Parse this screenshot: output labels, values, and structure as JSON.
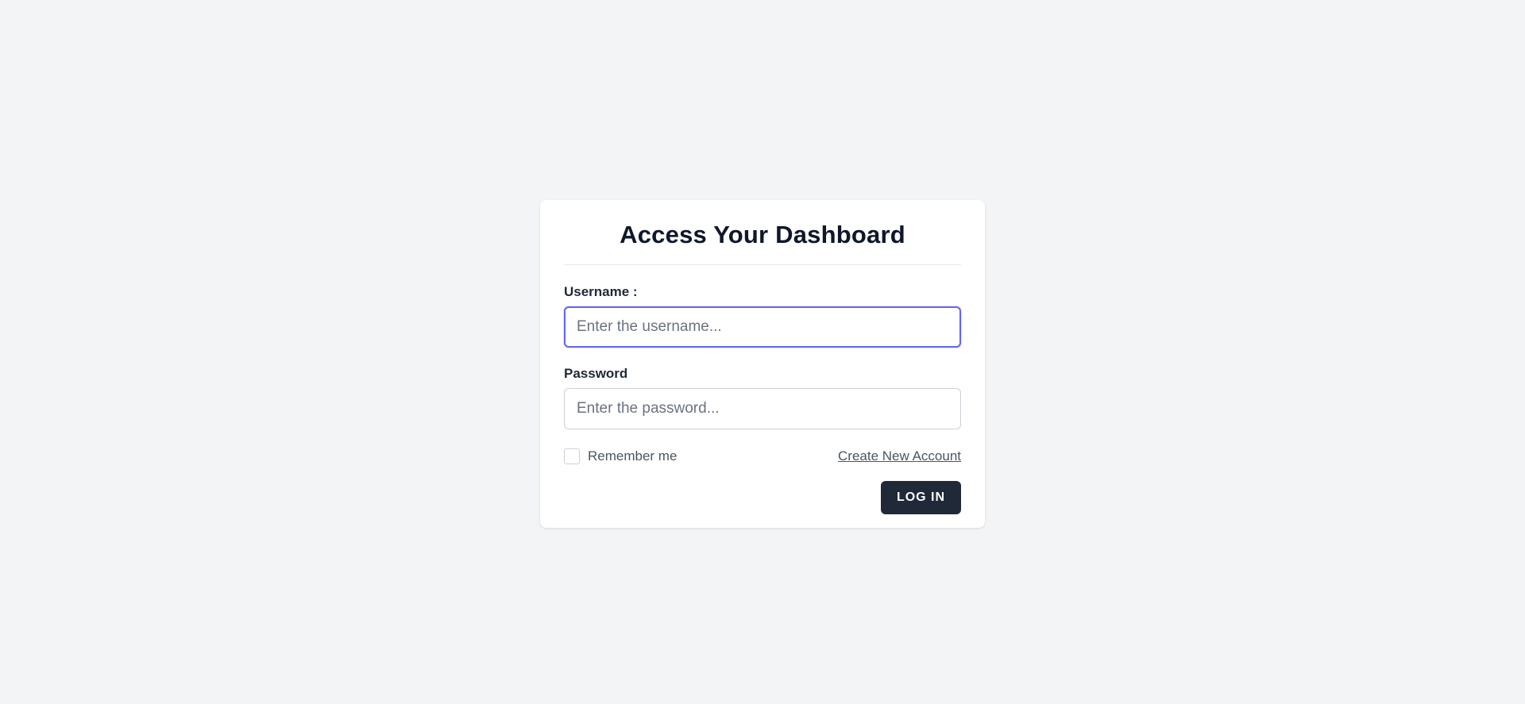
{
  "page": {
    "background_color": "#f3f4f6"
  },
  "login_card": {
    "title": "Access Your Dashboard",
    "username": {
      "label": "Username :",
      "placeholder": "Enter the username...",
      "value": "",
      "focused": true,
      "focus_color": "#6366f1"
    },
    "password": {
      "label": "Password",
      "placeholder": "Enter the password...",
      "value": ""
    },
    "remember_me": {
      "label": "Remember me",
      "checked": false
    },
    "create_account_link": "Create New Account",
    "login_button": {
      "label": "LOG IN",
      "color": "#1f2937"
    }
  }
}
